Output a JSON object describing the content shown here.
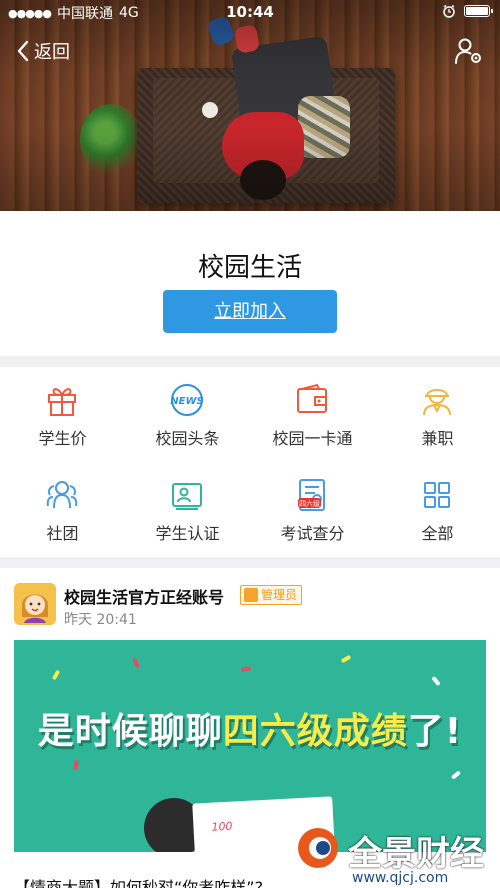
{
  "status_bar": {
    "signal_dots": "●●●●●",
    "carrier": "中国联通",
    "network": "4G",
    "time": "10:44"
  },
  "nav": {
    "back_label": "返回"
  },
  "club": {
    "title": "校园生活",
    "join_label": "立即加入"
  },
  "grid": {
    "items": [
      {
        "label": "学生价",
        "icon": "gift-icon",
        "color": "#f05a3a"
      },
      {
        "label": "校园头条",
        "icon": "news-icon",
        "color": "#2f8fe0",
        "icon_text": "NEWS"
      },
      {
        "label": "校园一卡通",
        "icon": "wallet-card-icon",
        "color": "#f05a3a"
      },
      {
        "label": "兼职",
        "icon": "worker-icon",
        "color": "#f3b53a"
      },
      {
        "label": "社团",
        "icon": "group-icon",
        "color": "#4a9be4"
      },
      {
        "label": "学生认证",
        "icon": "id-card-icon",
        "color": "#2fb597"
      },
      {
        "label": "考试查分",
        "icon": "exam-score-icon",
        "color": "#4a9be4",
        "icon_badge": "四六级"
      },
      {
        "label": "全部",
        "icon": "all-grid-icon",
        "color": "#4a9be4"
      }
    ]
  },
  "post": {
    "account": "校园生活官方正经账号",
    "role_badge": "管理员",
    "time": "昨天 20:41",
    "banner": {
      "text_start": "是时候聊聊",
      "text_highlight": "四六级成绩",
      "text_end": "了!",
      "paper_score": "100"
    },
    "headline": "【情商大题】如何秒怼“你考咋样”?"
  },
  "watermark": {
    "name": "全景财经",
    "url": "www.qjcj.com"
  },
  "colors": {
    "accent_blue": "#2f98e3",
    "banner_green": "#2fb597",
    "badge_orange": "#f3a52b"
  }
}
